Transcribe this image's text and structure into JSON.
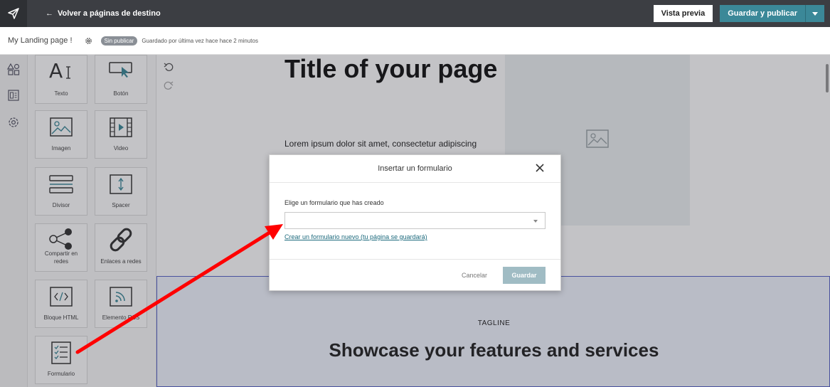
{
  "topbar": {
    "back_label": "Volver a páginas de destino",
    "preview_label": "Vista previa",
    "publish_label": "Guardar y publicar"
  },
  "subbar": {
    "page_name": "My Landing page !",
    "status_badge": "Sin publicar",
    "saved_text": "Guardado por última vez hace hace 2 minutos"
  },
  "palette": {
    "tiles": [
      {
        "label": "Texto",
        "icon": "text-icon"
      },
      {
        "label": "Botón",
        "icon": "button-icon"
      },
      {
        "label": "Imagen",
        "icon": "image-icon"
      },
      {
        "label": "Video",
        "icon": "video-icon"
      },
      {
        "label": "Divisor",
        "icon": "divider-icon"
      },
      {
        "label": "Spacer",
        "icon": "spacer-icon"
      },
      {
        "label": "Compartir en redes",
        "icon": "share-icon"
      },
      {
        "label": "Enlaces a redes",
        "icon": "link-icon"
      },
      {
        "label": "Bloque HTML",
        "icon": "html-icon"
      },
      {
        "label": "Elemento RSS",
        "icon": "rss-icon"
      },
      {
        "label": "Formulario",
        "icon": "form-icon"
      }
    ]
  },
  "canvas": {
    "hero_title": "Title of your page",
    "hero_text": "Lorem ipsum dolor sit amet, consectetur adipiscing",
    "tagline": "TAGLINE",
    "section_title": "Showcase your features and services"
  },
  "modal": {
    "title": "Insertar un formulario",
    "field_label": "Elige un formulario que has creado",
    "select_value": "",
    "create_link": "Crear un formulario nuevo (tu página se guardará)",
    "cancel_label": "Cancelar",
    "save_label": "Guardar"
  },
  "colors": {
    "topbar_bg": "#3c3e43",
    "accent": "#3b8898",
    "link": "#1d6a7d",
    "annotation_arrow": "#ff0000",
    "section_border": "#5663c9"
  }
}
